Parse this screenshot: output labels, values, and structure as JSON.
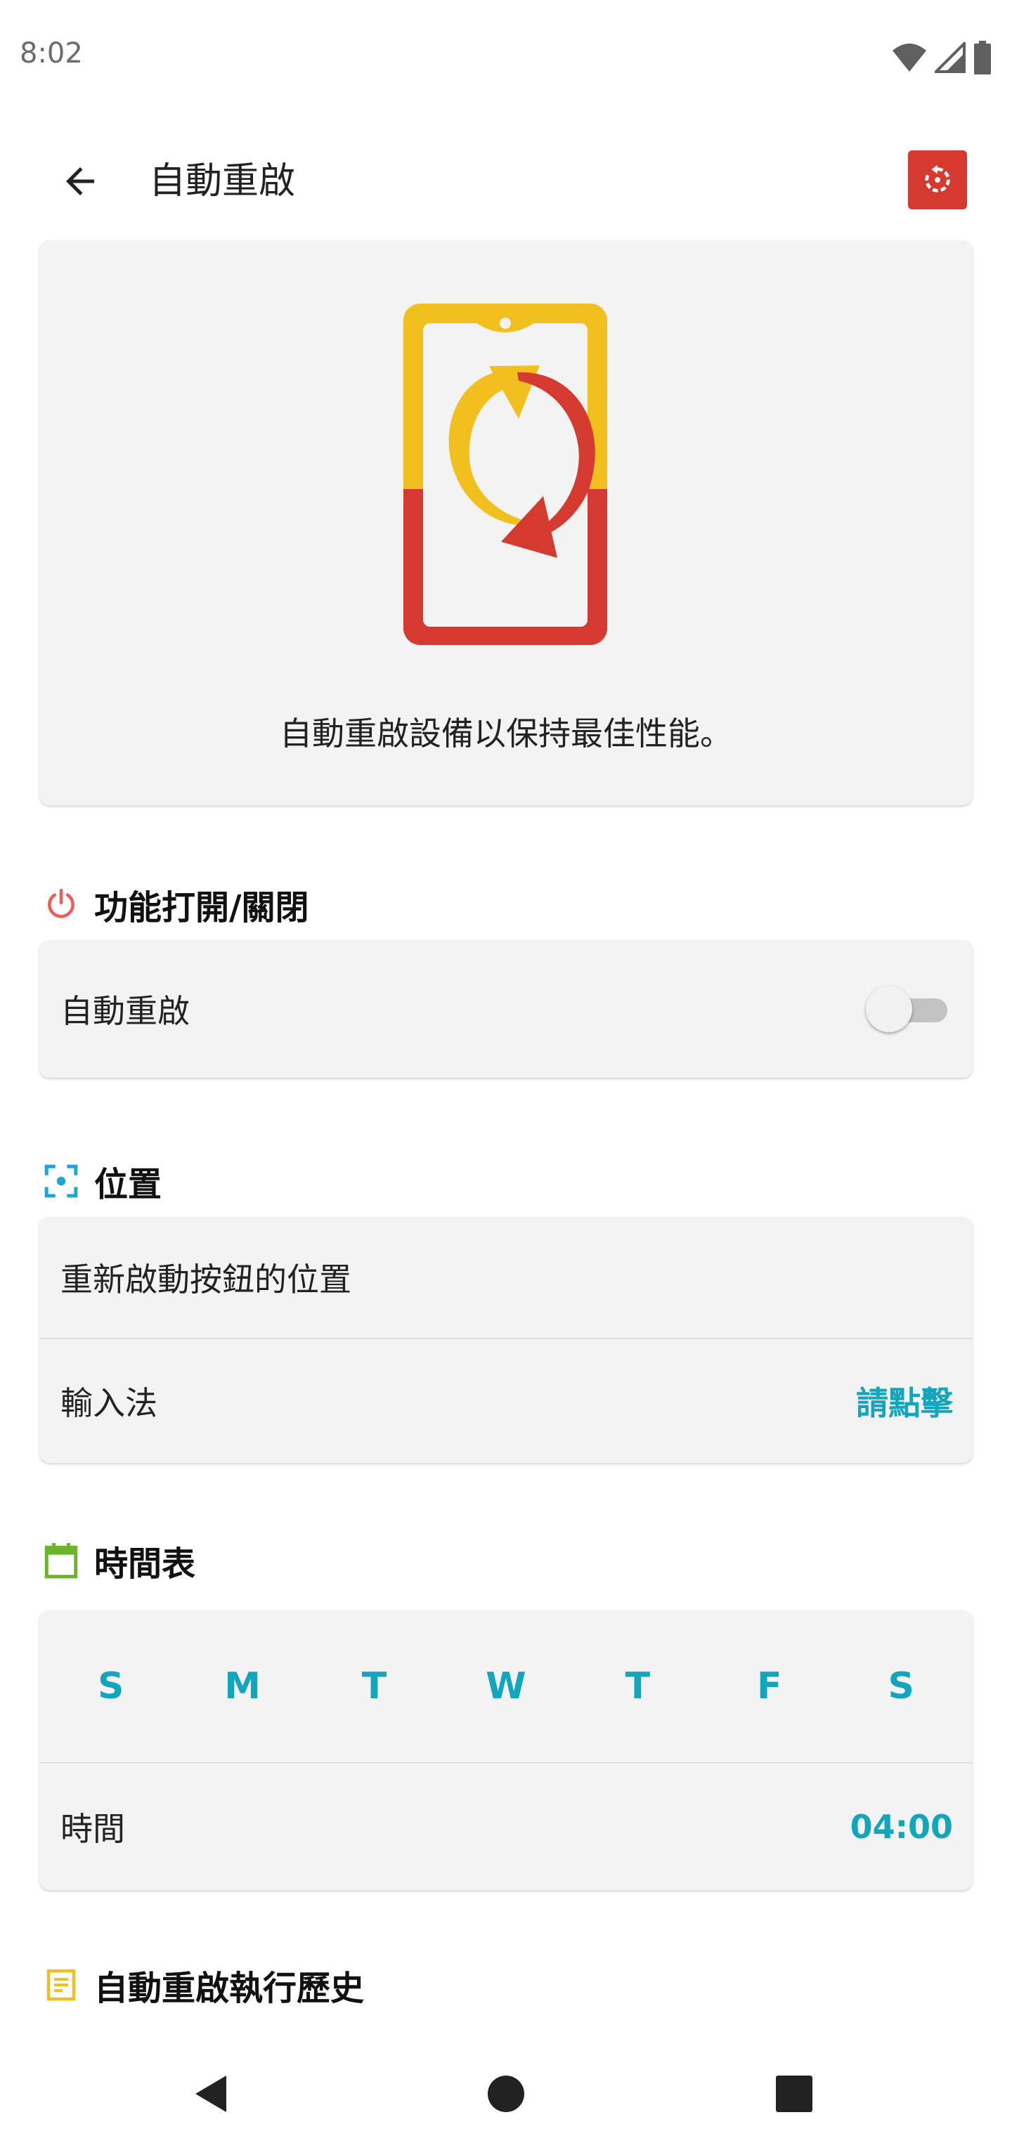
{
  "status_bar": {
    "time": "8:02"
  },
  "app_bar": {
    "title": "自動重啟"
  },
  "hero": {
    "description": "自動重啟設備以保持最佳性能。"
  },
  "sections": {
    "feature": {
      "title": "功能打開/關閉",
      "toggle_label": "自動重啟",
      "toggle_on": false
    },
    "position": {
      "title": "位置",
      "row1_label": "重新啟動按鈕的位置",
      "row2_label": "輸入法",
      "row2_value": "請點擊"
    },
    "schedule": {
      "title": "時間表",
      "days": [
        "S",
        "M",
        "T",
        "W",
        "T",
        "F",
        "S"
      ],
      "time_label": "時間",
      "time_value": "04:00"
    },
    "history": {
      "title": "自動重啟執行歷史"
    }
  },
  "colors": {
    "accent": "#13a5bd",
    "brand_red": "#d43a30",
    "brand_yellow": "#f2c01e",
    "power_icon": "#e8605a",
    "location_icon": "#1aa7d6",
    "calendar_icon": "#6cb52a",
    "history_icon": "#f2c01e"
  },
  "icons": {
    "back": "arrow-left-icon",
    "action": "restart-icon",
    "feature": "power-icon",
    "position": "target-icon",
    "schedule": "calendar-icon",
    "history": "notes-icon",
    "nav": [
      "back-triangle-icon",
      "home-circle-icon",
      "recents-square-icon"
    ]
  }
}
